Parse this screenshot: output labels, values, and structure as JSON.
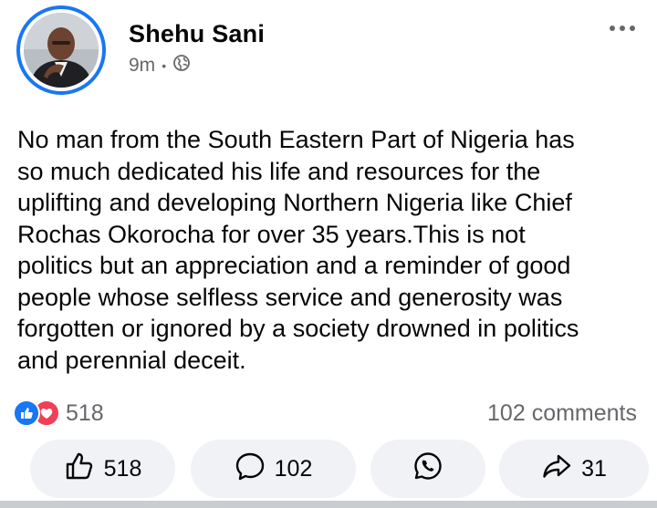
{
  "post": {
    "author_name": "Shehu Sani",
    "timestamp": "9m",
    "separator": "•",
    "privacy_icon": "globe-icon",
    "more_icon": "more-horizontal-icon",
    "text": "No man from the South Eastern Part of Nigeria has\nso much dedicated his life and resources for the\nuplifting and developing Northern Nigeria like Chief\nRochas Okorocha for over 35 years.This is not\npolitics but an appreciation and a reminder of good\npeople whose selfless service and generosity was\nforgotten or ignored by a society drowned in politics\nand perennial deceit."
  },
  "reactions": {
    "icons": [
      "like-reaction-icon",
      "love-reaction-icon"
    ],
    "count": "518",
    "comments": "102 comments"
  },
  "actions": {
    "like": {
      "icon": "thumbs-up-icon",
      "count": "518"
    },
    "comment": {
      "icon": "comment-bubble-icon",
      "count": "102"
    },
    "whatsapp": {
      "icon": "whatsapp-icon"
    },
    "share": {
      "icon": "share-arrow-icon",
      "count": "31"
    }
  },
  "colors": {
    "accent": "#1877f2",
    "love": "#f33e58",
    "secondary_text": "#65676b",
    "button_bg": "#f0f2f5"
  }
}
